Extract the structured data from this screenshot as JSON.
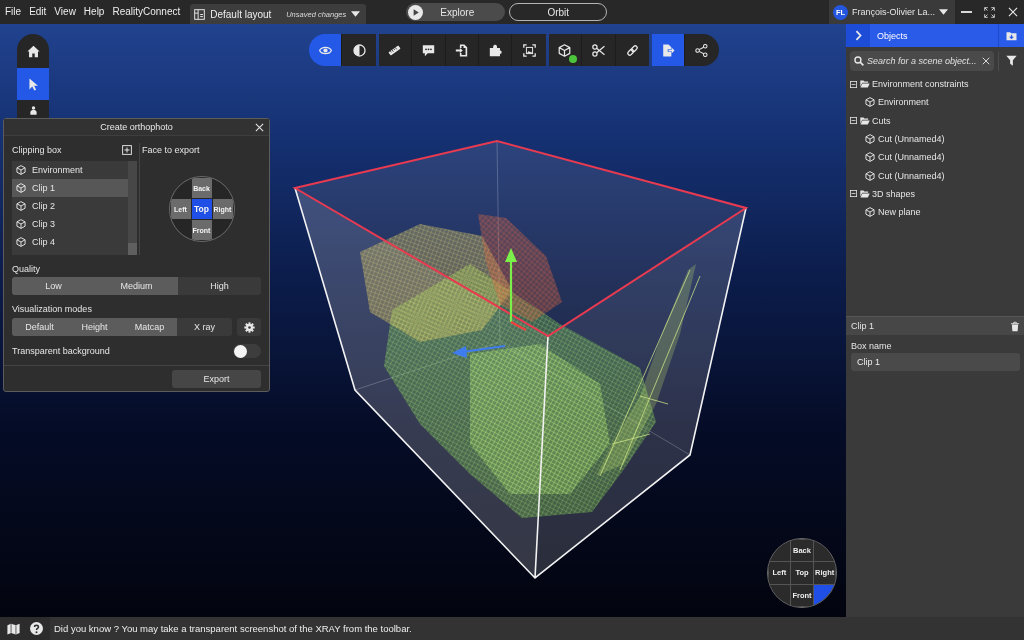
{
  "menu_bar": {
    "menus": [
      "File",
      "Edit",
      "View",
      "Help",
      "RealityConnect"
    ],
    "layout": {
      "name": "Default layout",
      "status": "Unsaved changes"
    },
    "explore_button": {
      "label": "Explore"
    },
    "orbit_button": {
      "label": "Orbit"
    },
    "user": {
      "initials": "FL",
      "name": "François-Olivier La..."
    }
  },
  "left_toolbar": {
    "buttons": [
      {
        "selected": false
      },
      {
        "selected": true
      },
      {
        "selected": false
      }
    ]
  },
  "view_toolbar": {
    "groups": [
      {
        "buttons": [
          {
            "selected": true,
            "indicator": false
          },
          {
            "selected": false,
            "indicator": false
          }
        ]
      },
      {
        "buttons": [
          {
            "selected": false,
            "indicator": false
          },
          {
            "selected": false,
            "indicator": false
          },
          {
            "selected": false,
            "indicator": false
          },
          {
            "selected": false,
            "indicator": false
          },
          {
            "selected": false,
            "indicator": false
          }
        ]
      },
      {
        "buttons": [
          {
            "selected": false,
            "indicator": true
          },
          {
            "selected": false,
            "indicator": false
          },
          {
            "selected": false,
            "indicator": false
          }
        ]
      },
      {
        "buttons": [
          {
            "selected": true,
            "indicator": false
          },
          {
            "selected": false,
            "indicator": false
          }
        ]
      }
    ]
  },
  "orthophoto_dialog": {
    "title": "Create orthophoto",
    "clipping_box": {
      "label": "Clipping box",
      "items": [
        {
          "label": "Environment",
          "selected": false
        },
        {
          "label": "Clip 1",
          "selected": true
        },
        {
          "label": "Clip 2",
          "selected": false
        },
        {
          "label": "Clip 3",
          "selected": false
        },
        {
          "label": "Clip 4",
          "selected": false
        }
      ]
    },
    "face_to_export": {
      "label": "Face to export",
      "faces": [
        {
          "label": "Back",
          "selected": false
        },
        {
          "label": "Left",
          "selected": false
        },
        {
          "label": "Top",
          "selected": true
        },
        {
          "label": "Right",
          "selected": false
        },
        {
          "label": "Front",
          "selected": false
        }
      ]
    },
    "quality": {
      "label": "Quality",
      "options": [
        {
          "label": "Low",
          "selected": true
        },
        {
          "label": "Medium",
          "selected": true
        },
        {
          "label": "High",
          "selected": false
        }
      ]
    },
    "visualization_modes": {
      "label": "Visualization modes",
      "options": [
        {
          "label": "Default",
          "selected": true
        },
        {
          "label": "Height",
          "selected": true
        },
        {
          "label": "Matcap",
          "selected": true
        },
        {
          "label": "X ray",
          "selected": false
        }
      ]
    },
    "transparent_background": {
      "label": "Transparent background",
      "on": false
    },
    "export_button": {
      "label": "Export"
    }
  },
  "view_cube": {
    "cells": [
      {
        "selected": false
      },
      {
        "label": "Back",
        "selected": false
      },
      {
        "selected": false
      },
      {
        "label": "Left",
        "selected": false
      },
      {
        "label": "Top",
        "selected": false
      },
      {
        "label": "Right",
        "selected": false
      },
      {
        "selected": false
      },
      {
        "label": "Front",
        "selected": false
      },
      {
        "selected": true
      }
    ]
  },
  "objects_panel": {
    "title": "Objects",
    "search": {
      "placeholder": "Search for a scene object..."
    },
    "tree": [
      {
        "label": "Environment constraints",
        "expanded": true,
        "children": [
          {
            "label": "Environment"
          }
        ]
      },
      {
        "label": "Cuts",
        "expanded": true,
        "children": [
          {
            "label": "Cut (Unnamed4)"
          },
          {
            "label": "Cut (Unnamed4)"
          },
          {
            "label": "Cut (Unnamed4)"
          }
        ]
      },
      {
        "label": "3D shapes",
        "expanded": true,
        "children": [
          {
            "label": "New plane"
          }
        ]
      }
    ]
  },
  "properties_panel": {
    "title": "Clip 1",
    "fields": [
      {
        "label": "Box name",
        "value": "Clip 1"
      }
    ]
  },
  "status_bar": {
    "tip": "Did you know ? You may take a transparent screenshot of the XRAY from the toolbar."
  }
}
